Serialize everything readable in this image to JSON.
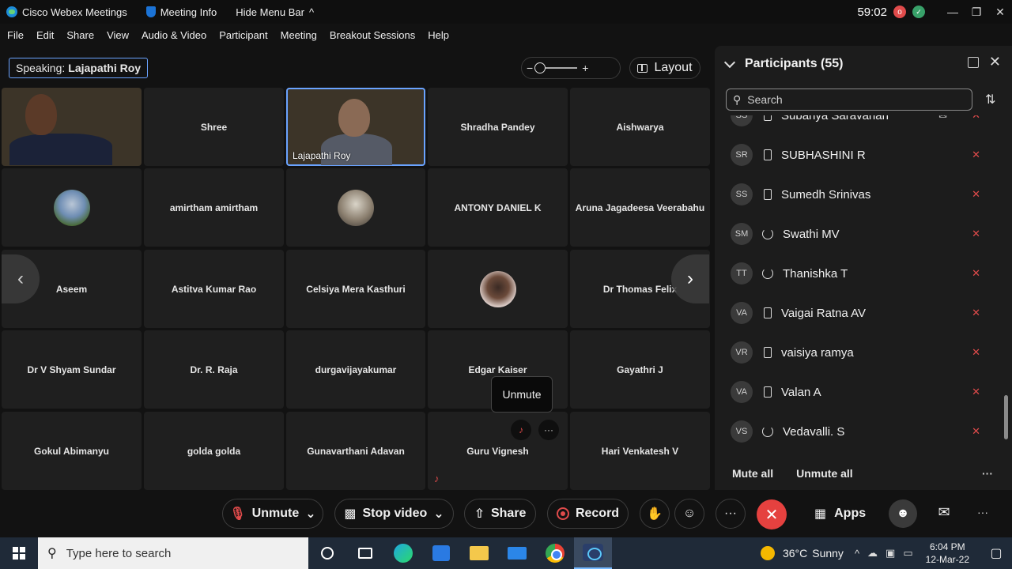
{
  "titlebar": {
    "app_name": "Cisco Webex Meetings",
    "meeting_info": "Meeting Info",
    "hide_menu": "Hide Menu Bar",
    "hide_menu_chevron": "^",
    "timer": "59:02",
    "rec_icon_glyph": "o",
    "status_icon_glyph": "✓",
    "minimize": "—",
    "restore": "❐",
    "close": "✕"
  },
  "menu": [
    "File",
    "Edit",
    "Share",
    "View",
    "Audio & Video",
    "Participant",
    "Meeting",
    "Breakout Sessions",
    "Help"
  ],
  "speaking": {
    "label": "Speaking:",
    "name": "Lajapathi Roy"
  },
  "zoom": {
    "minus": "−",
    "plus": "+"
  },
  "layout_label": "Layout",
  "tiles": [
    {
      "name": "",
      "type": "video",
      "icon": "person-video"
    },
    {
      "name": "Shree"
    },
    {
      "name": "Lajapathi Roy",
      "type": "video-active"
    },
    {
      "name": "Shradha Pandey"
    },
    {
      "name": "Aishwarya"
    },
    {
      "name": "",
      "type": "avatar"
    },
    {
      "name": "amirtham amirtham"
    },
    {
      "name": "",
      "type": "avatar"
    },
    {
      "name": "ANTONY DANIEL K"
    },
    {
      "name": "Aruna Jagadeesa Veerabahu"
    },
    {
      "name": "Aseem"
    },
    {
      "name": "Astitva Kumar Rao"
    },
    {
      "name": "Celsiya Mera Kasthuri"
    },
    {
      "name": "",
      "type": "avatar"
    },
    {
      "name": "Dr Thomas Felix"
    },
    {
      "name": "Dr V Shyam Sundar"
    },
    {
      "name": "Dr. R. Raja"
    },
    {
      "name": "durgavijayakumar"
    },
    {
      "name": "Edgar Kaiser"
    },
    {
      "name": "Gayathri J"
    },
    {
      "name": "Gokul Abimanyu"
    },
    {
      "name": "golda golda"
    },
    {
      "name": "Gunavarthani Adavan"
    },
    {
      "name": "Guru Vignesh"
    },
    {
      "name": "Hari Venkatesh V"
    }
  ],
  "nav": {
    "prev": "‹",
    "next": "›"
  },
  "tooltip": "Unmute",
  "tile_more": "···",
  "tile_mic": "♪",
  "participants": {
    "title": "Participants (55)",
    "popout": "",
    "close": "✕",
    "search_placeholder": "Search",
    "sort": "⇅",
    "rows": [
      {
        "initials": "SS",
        "name": "Subanya Saravanan",
        "device": "phone",
        "chat": "✉"
      },
      {
        "initials": "SR",
        "name": "SUBHASHINI R",
        "device": "phone"
      },
      {
        "initials": "SS",
        "name": "Sumedh Srinivas",
        "device": "phone"
      },
      {
        "initials": "SM",
        "name": "Swathi MV",
        "device": "sync"
      },
      {
        "initials": "TT",
        "name": "Thanishka T",
        "device": "sync"
      },
      {
        "initials": "VA",
        "name": "Vaigai Ratna AV",
        "device": "phone"
      },
      {
        "initials": "VR",
        "name": "vaisiya ramya",
        "device": "phone"
      },
      {
        "initials": "VA",
        "name": "Valan A",
        "device": "phone"
      },
      {
        "initials": "VS",
        "name": "Vedavalli. S",
        "device": "sync"
      }
    ],
    "muted_glyph": "✕",
    "mute_all": "Mute all",
    "unmute_all": "Unmute all",
    "more": "···"
  },
  "controls": {
    "unmute": "Unmute",
    "stop_video": "Stop video",
    "share": "Share",
    "record": "Record",
    "raise_hand": "✋",
    "reactions": "☺",
    "more": "···",
    "leave": "✕",
    "apps": "Apps",
    "participants_icon": "☻",
    "chat_icon": "✉",
    "overflow": "···",
    "dropdown": "⌄"
  },
  "taskbar": {
    "search_placeholder": "Type here to search",
    "temperature": "36°C",
    "weather": "Sunny",
    "time": "6:04 PM",
    "date": "12-Mar-22",
    "tray_up": "^",
    "tray_cloud": "☁",
    "tray_net": "▣",
    "tray_battery": "▭",
    "notification": "▢"
  },
  "colors": {
    "background": "#121212",
    "tile": "#1f1f1f",
    "panel": "#1c1c1c",
    "accent": "#6aa3ff",
    "muted_red": "#e04b4b",
    "leave_red": "#e5413f",
    "taskbar": "#1f2a38"
  }
}
